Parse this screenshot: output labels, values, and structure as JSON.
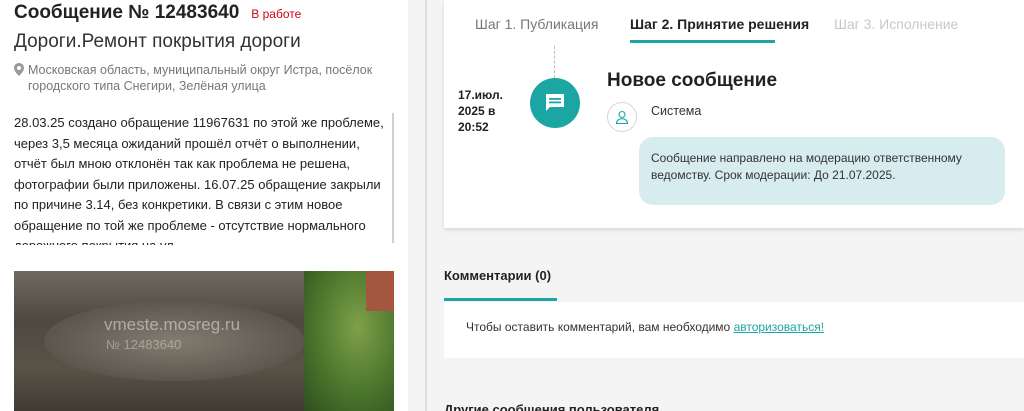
{
  "report": {
    "title": "Сообщение № 12483640",
    "status": "В работе",
    "category": "Дороги.Ремонт покрытия дороги",
    "address": "Московская область, муниципальный округ Истра, посёлок городского типа Снегири, Зелёная улица",
    "description": "28.03.25 создано обращение 11967631 по этой же проблеме, через 3,5 месяца ожиданий прошёл отчёт о выполнении, отчёт был мною отклонён так как проблема не решена, фотографии были приложены. 16.07.25 обращение закрыли по причине 3.14, без конкретики. В связи с этим новое обращение по той же проблеме - отсутствие нормального дорожного покрытия на ул.",
    "photo_watermark": "vmeste.mosreg.ru",
    "photo_watermark_id": "№ 12483640"
  },
  "steps": [
    {
      "label": "Шаг 1. Публикация"
    },
    {
      "label": "Шаг 2. Принятие решения"
    },
    {
      "label": "Шаг 3. Исполнение"
    }
  ],
  "event": {
    "date": "17.июл. 2025 в 20:52",
    "title": "Новое сообщение",
    "author": "Система",
    "message": "Сообщение направлено на модерацию ответственному ведомству. Срок модерации: До 21.07.2025."
  },
  "comments": {
    "title": "Комментарии (0)",
    "login_prompt": "Чтобы оставить комментарий, вам необходимо ",
    "login_link": "авторизоваться!"
  },
  "other_reports_title": "Другие сообщения пользователя",
  "colors": {
    "accent": "#1ba6a4",
    "status": "#d0021b",
    "bubble": "#d7ecee"
  },
  "icons": {
    "address": "map-pin-icon",
    "event": "chat-message-icon",
    "author": "user-icon"
  }
}
